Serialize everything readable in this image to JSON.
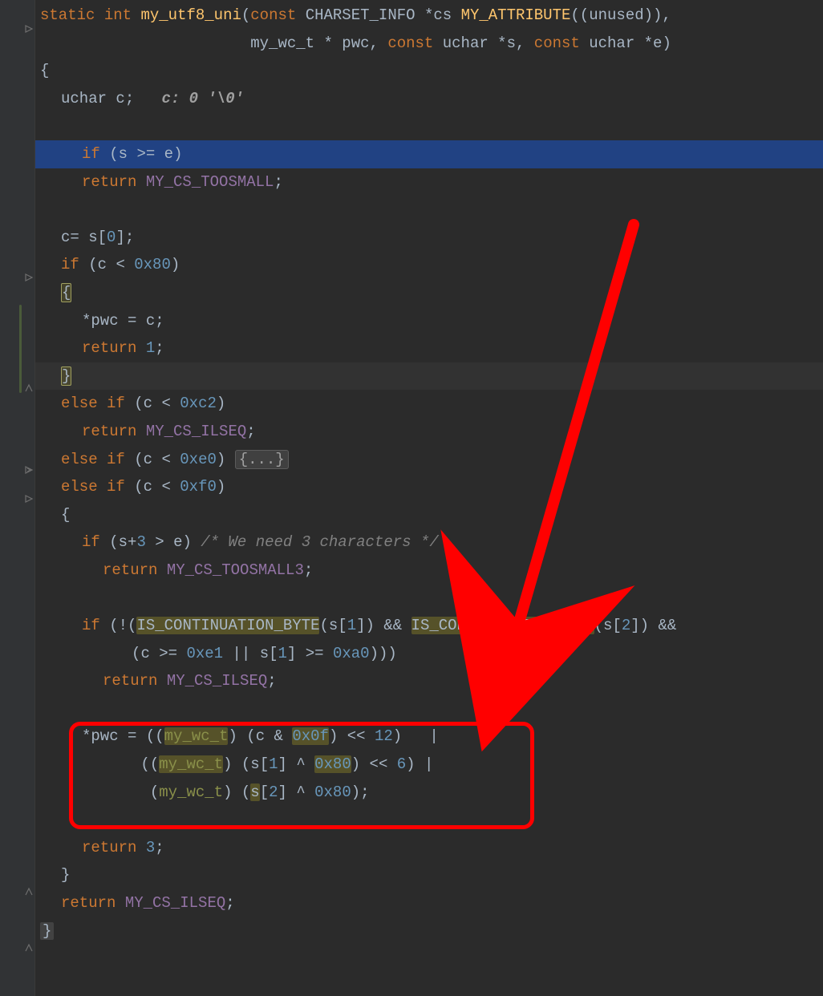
{
  "code": {
    "l1": {
      "kw_static": "static",
      "kw_int": "int",
      "fn": "my_utf8_uni",
      "kw_const": "const",
      "type1": "CHARSET_INFO",
      "star": "*",
      "p_cs": "cs",
      "macro": "MY_ATTRIBUTE",
      "unused": "unused"
    },
    "l2": {
      "type1": "my_wc_t",
      "star": "*",
      "p_pwc": "pwc",
      "kw_const": "const",
      "type2": "uchar",
      "p_s": "s",
      "p_e": "e"
    },
    "l3": {
      "brace": "{"
    },
    "l4": {
      "type": "uchar",
      "var": "c",
      "semi": ";",
      "hint": "c: 0 '\\0'"
    },
    "l6": {
      "kw_if": "if",
      "expr": "(s >= e)",
      "p_s": "s",
      "ge": ">=",
      "p_e": "e"
    },
    "l7": {
      "kw_return": "return",
      "val": "MY_CS_TOOSMALL",
      "semi": ";"
    },
    "l9": {
      "lhs": "c",
      "eq": "=",
      "rhs": "s",
      "idx": "0",
      "semi": ";"
    },
    "l10": {
      "kw_if": "if",
      "c": "c",
      "lt": "<",
      "hex": "0x80"
    },
    "l11": {
      "brace": "{"
    },
    "l12": {
      "deref": "*",
      "pwc": "pwc",
      "eq": "=",
      "c": "c",
      "semi": ";"
    },
    "l13": {
      "kw_return": "return",
      "one": "1",
      "semi": ";"
    },
    "l14": {
      "brace": "}"
    },
    "l15": {
      "kw_else": "else",
      "kw_if": "if",
      "c": "c",
      "lt": "<",
      "hex": "0xc2"
    },
    "l16": {
      "kw_return": "return",
      "val": "MY_CS_ILSEQ",
      "semi": ";"
    },
    "l17": {
      "kw_else": "else",
      "kw_if": "if",
      "c": "c",
      "lt": "<",
      "hex": "0xe0",
      "fold": "{...}"
    },
    "l18": {
      "kw_else": "else",
      "kw_if": "if",
      "c": "c",
      "lt": "<",
      "hex": "0xf0"
    },
    "l19": {
      "brace": "{"
    },
    "l20": {
      "kw_if": "if",
      "s": "s",
      "plus": "+",
      "three": "3",
      "gt": ">",
      "e": "e",
      "cmt": "/* We need 3 characters */"
    },
    "l21": {
      "kw_return": "return",
      "val": "MY_CS_TOOSMALL3",
      "semi": ";"
    },
    "l23": {
      "kw_if": "if",
      "bang": "!",
      "macro": "IS_CONTINUATION_BYTE",
      "s": "s",
      "one": "1",
      "amp": "&&",
      "two": "2"
    },
    "l24": {
      "c": "c",
      "ge": ">=",
      "hex1": "0xe1",
      "or": "||",
      "s": "s",
      "one": "1",
      "hex2": "0xa0"
    },
    "l25": {
      "kw_return": "return",
      "val": "MY_CS_ILSEQ",
      "semi": ";"
    },
    "l27": {
      "deref": "*",
      "pwc": "pwc",
      "eq": "=",
      "cast": "my_wc_t",
      "c": "c",
      "amp": "&",
      "hex": "0x0f",
      "sh": "<<",
      "twelve": "12",
      "bar": "|"
    },
    "l28": {
      "cast": "my_wc_t",
      "s": "s",
      "one": "1",
      "caret": "^",
      "hex": "0x80",
      "sh": "<<",
      "six": "6",
      "bar": "|"
    },
    "l29": {
      "cast": "my_wc_t",
      "s": "s",
      "two": "2",
      "caret": "^",
      "hex": "0x80",
      "semi": ";"
    },
    "l31": {
      "kw_return": "return",
      "three": "3",
      "semi": ";"
    },
    "l32": {
      "brace": "}"
    },
    "l33": {
      "kw_return": "return",
      "val": "MY_CS_ILSEQ",
      "semi": ";"
    },
    "l34": {
      "brace": "}"
    }
  }
}
